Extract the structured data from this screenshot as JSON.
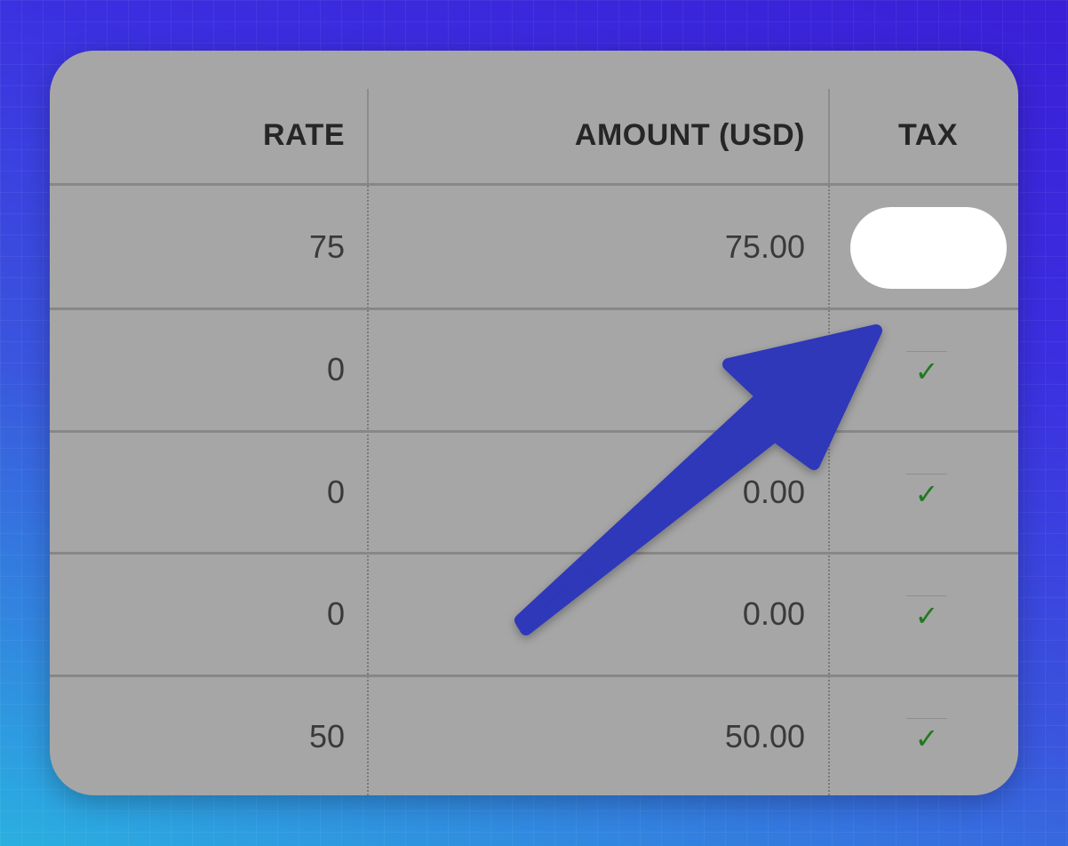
{
  "table": {
    "headers": {
      "rate": "RATE",
      "amount": "AMOUNT (USD)",
      "tax": "TAX"
    },
    "rows": [
      {
        "rate": "75",
        "amount": "75.00",
        "tax": ""
      },
      {
        "rate": "0",
        "amount": "",
        "tax": "✓"
      },
      {
        "rate": "0",
        "amount": "0.00",
        "tax": "✓"
      },
      {
        "rate": "0",
        "amount": "0.00",
        "tax": "✓"
      },
      {
        "rate": "50",
        "amount": "50.00",
        "tax": "✓"
      }
    ]
  },
  "colors": {
    "card": "#a6a6a6",
    "check": "#1f7a1f",
    "arrow": "#2f37b8"
  },
  "annotation": {
    "icon": "pointer-arrow-icon"
  }
}
